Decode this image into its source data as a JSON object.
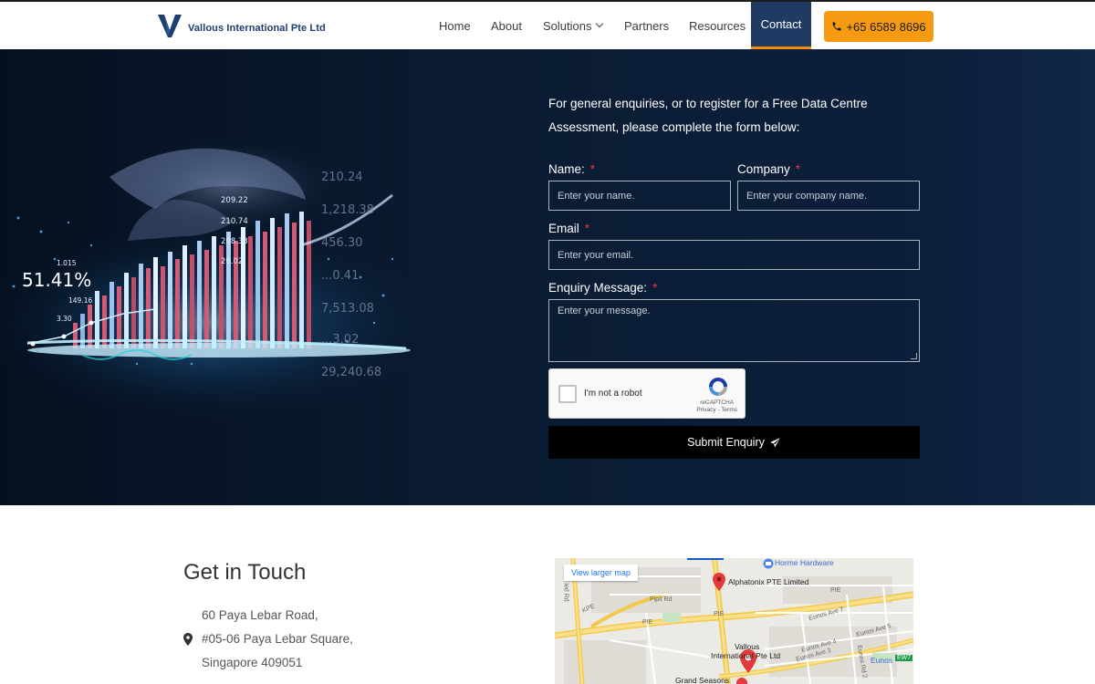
{
  "header": {
    "logo_text": "Vallous International Pte Ltd",
    "nav": [
      "Home",
      "About",
      "Solutions",
      "Partners",
      "Resources",
      "Contact"
    ],
    "phone": "+65 6589 8696"
  },
  "hero": {
    "intro": "For general enquiries, or to register for a Free Data Centre Assessment, please complete the form below:",
    "chart_numbers": {
      "big": "51.41%",
      "left": [
        "1.015",
        "149.16",
        "3.30"
      ],
      "mid": [
        "209.22",
        "210.74",
        "208.33",
        "26.02"
      ],
      "right": [
        "210.24",
        "1,218.38",
        "456.30",
        "...0.41",
        "7,513.08",
        "...3.02",
        "29,240.68"
      ]
    }
  },
  "form": {
    "name_label": "Name:",
    "name_placeholder": "Enter your name.",
    "company_label": "Company",
    "company_placeholder": "Enter your company name.",
    "email_label": "Email",
    "email_placeholder": "Enter your email.",
    "message_label": "Enquiry Message:",
    "message_placeholder": "Enter your message.",
    "required_mark": "*",
    "captcha_text": "I'm not a robot",
    "captcha_brand": "reCAPTCHA",
    "captcha_links": "Privacy - Terms",
    "submit_label": "Submit Enquiry"
  },
  "contact": {
    "title": "Get in Touch",
    "address_line1": "60 Paya Lebar Road,",
    "address_line2": "#05-06 Paya Lebar Square,",
    "address_line3": "Singapore 409051"
  },
  "map": {
    "view_larger": "View larger map",
    "places": {
      "horme": "Horme Hardware",
      "alphatonix": "Alphatonix PTE Limited",
      "vallous_1": "Vallous",
      "vallous_2": "International Pte Ltd",
      "grand": "Grand Seasons",
      "eunos": "Eunos",
      "ew7": "EW7"
    },
    "roads": {
      "kpe": "KPE",
      "pie1": "PIE",
      "pie2": "PIE",
      "pie3": "PIE",
      "pipit": "Pipit Rd",
      "ipit": "ied Rd",
      "eunos7": "Eunos Ave 7",
      "eunos5": "Eunos Ave 5",
      "eunos4": "Eunos Ave 4",
      "eunos3": "Eunos Ave 3",
      "eunosrd2": "Eunos Rd 2"
    }
  }
}
